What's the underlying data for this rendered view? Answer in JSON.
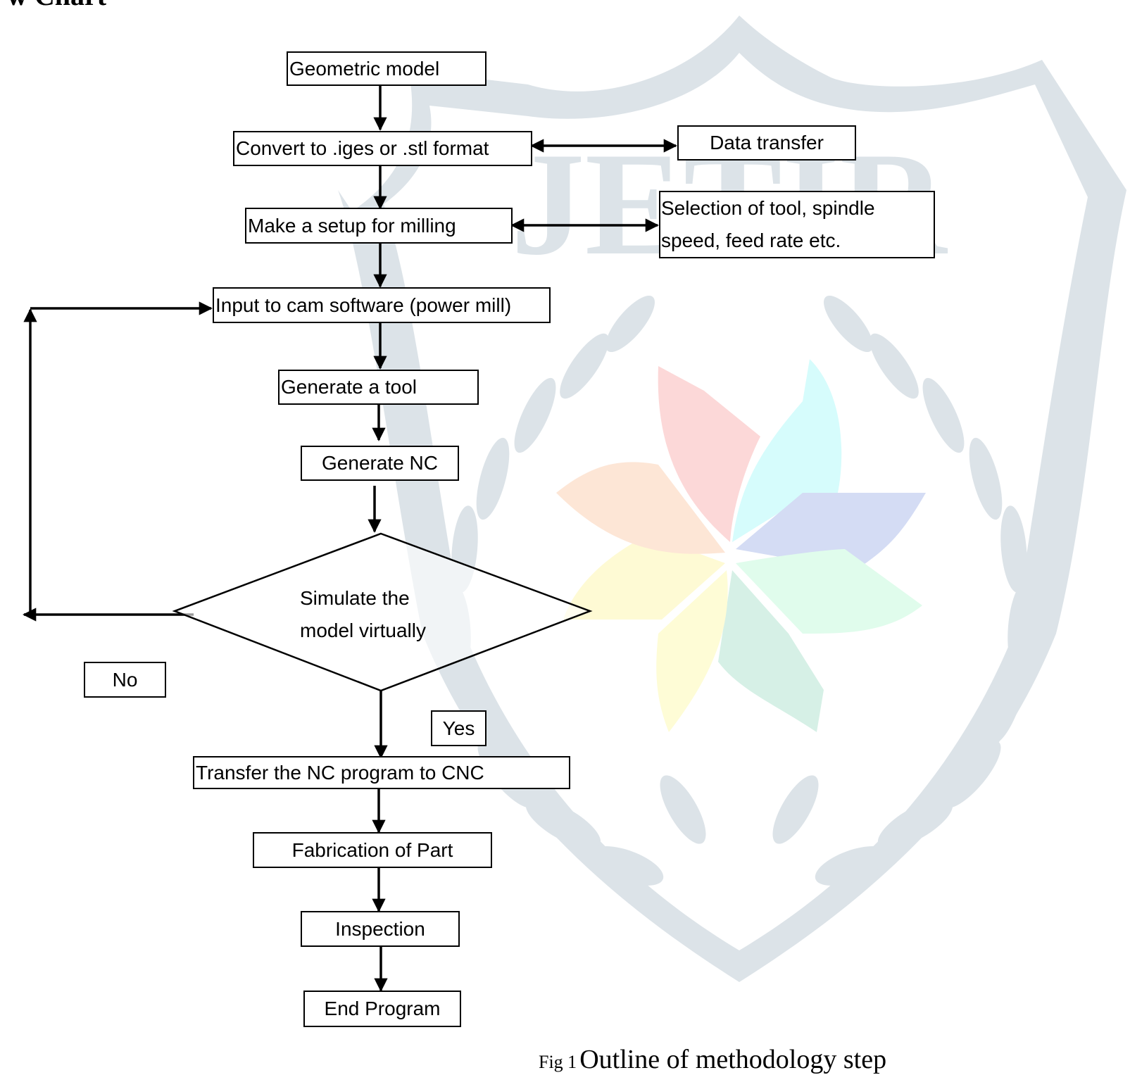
{
  "heading": "w Chart",
  "watermark": {
    "text": "JETIR",
    "shield_color": "#dce3e8",
    "petal_colors": [
      "#fcd8d8",
      "#d6fcfc",
      "#d4dcf4",
      "#e0fcec",
      "#d6f0e6",
      "#fefcd6",
      "#fefad4",
      "#fde6d6"
    ]
  },
  "flowchart": {
    "steps": [
      {
        "id": "geometric-model",
        "label": "Geometric model"
      },
      {
        "id": "convert-format",
        "label": "Convert to .iges or .stl format"
      },
      {
        "id": "setup-milling",
        "label": "Make a setup for milling"
      },
      {
        "id": "input-cam",
        "label": "Input to cam software (power mill)"
      },
      {
        "id": "generate-tool",
        "label": "Generate a tool"
      },
      {
        "id": "generate-nc",
        "label": "Generate NC"
      },
      {
        "id": "simulate",
        "label_line1": "Simulate the",
        "label_line2": "model virtually"
      },
      {
        "id": "transfer-nc",
        "label": "Transfer the NC program to CNC"
      },
      {
        "id": "fabrication",
        "label": "Fabrication of Part"
      },
      {
        "id": "inspection",
        "label": "Inspection"
      },
      {
        "id": "end-program",
        "label": "End Program"
      }
    ],
    "side_boxes": {
      "data_transfer": "Data transfer",
      "selection_line1": "Selection of tool, spindle",
      "selection_line2": "speed, feed rate etc."
    },
    "branch_labels": {
      "no": "No",
      "yes": "Yes"
    }
  },
  "caption": {
    "prefix": "Fig 1",
    "title": "Outline of methodology step"
  }
}
